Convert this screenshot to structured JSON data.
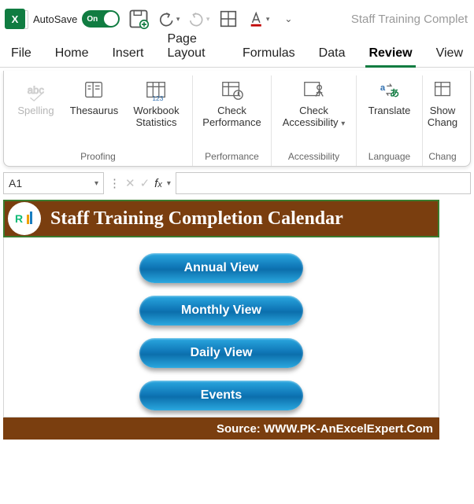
{
  "titlebar": {
    "autosave_label": "AutoSave",
    "autosave_state": "On",
    "document_title": "Staff Training Complet"
  },
  "tabs": {
    "file": "File",
    "home": "Home",
    "insert": "Insert",
    "page_layout": "Page Layout",
    "formulas": "Formulas",
    "data": "Data",
    "review": "Review",
    "view": "View"
  },
  "ribbon": {
    "proofing": {
      "spelling": "Spelling",
      "thesaurus": "Thesaurus",
      "workbook_stats_l1": "Workbook",
      "workbook_stats_l2": "Statistics",
      "group": "Proofing"
    },
    "performance": {
      "check_l1": "Check",
      "check_l2": "Performance",
      "group": "Performance"
    },
    "accessibility": {
      "check_l1": "Check",
      "check_l2": "Accessibility",
      "group": "Accessibility"
    },
    "language": {
      "translate": "Translate",
      "group": "Language"
    },
    "changes": {
      "show_l1": "Show",
      "show_l2": "Chang",
      "group": "Chang"
    }
  },
  "formula_bar": {
    "cell_ref": "A1",
    "value": ""
  },
  "worksheet": {
    "banner_title": "Staff Training Completion Calendar",
    "buttons": [
      "Annual View",
      "Monthly View",
      "Daily View",
      "Events"
    ],
    "source": "Source: WWW.PK-AnExcelExpert.Com"
  }
}
